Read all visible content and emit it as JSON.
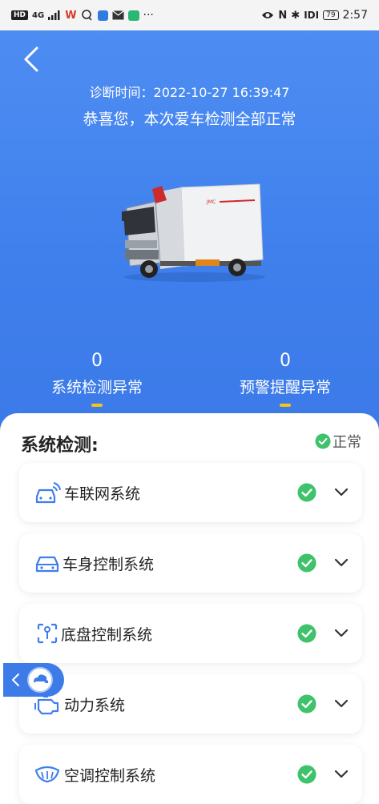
{
  "status_bar": {
    "left_badge": "HD",
    "signal": "4G",
    "time": "2:57",
    "battery": "79"
  },
  "header": {
    "diagnosis_time": "诊断时间：2022-10-27 16:39:47",
    "congrats": "恭喜您，本次爱车检测全部正常"
  },
  "stats": [
    {
      "value": "0",
      "label": "系统检测异常"
    },
    {
      "value": "0",
      "label": "预警提醒异常"
    }
  ],
  "section": {
    "title": "系统检测:",
    "status": "正常"
  },
  "systems": [
    {
      "label": "车联网系统",
      "icon": "connected-car-icon"
    },
    {
      "label": "车身控制系统",
      "icon": "car-body-icon"
    },
    {
      "label": "底盘控制系统",
      "icon": "chassis-icon"
    },
    {
      "label": "动力系统",
      "icon": "engine-icon"
    },
    {
      "label": "空调控制系统",
      "icon": "air-conditioning-icon"
    }
  ],
  "colors": {
    "primary": "#3f7fec",
    "ok_green": "#3ec26b",
    "indicator_yellow": "#f5c518"
  }
}
